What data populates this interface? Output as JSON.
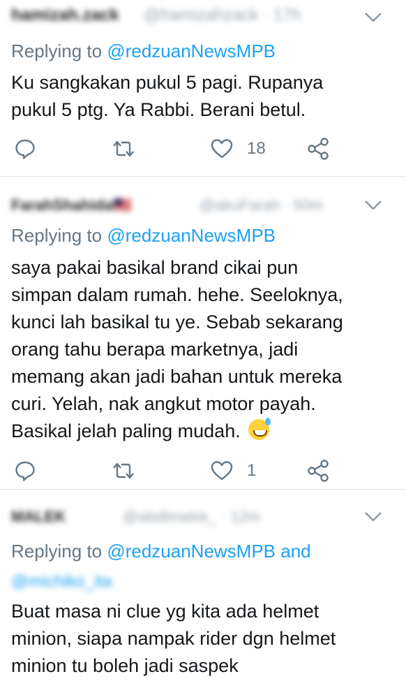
{
  "tweets": [
    {
      "author": "hamizah.zack",
      "handle": "@hamizahzack · 17h",
      "replying_prefix": "Replying to ",
      "replying_mention": "@redzuanNewsMPB",
      "text_lines": [
        "Ku sangkakan pukul 5 pagi. Rupanya",
        "pukul 5 ptg. Ya Rabbi. Berani betul."
      ],
      "likes": "18"
    },
    {
      "author": "FarahShahida🇲🇾",
      "handle": "@akuFarah · 50m",
      "replying_prefix": "Replying to ",
      "replying_mention": "@redzuanNewsMPB",
      "text_lines": [
        "saya pakai basikal brand cikai pun",
        "simpan dalam rumah. hehe. Seeloknya,",
        "kunci lah basikal tu ye. Sebab sekarang",
        "orang tahu berapa marketnya, jadi",
        "memang akan jadi bahan untuk mereka",
        "curi. Yelah, nak angkut motor payah.",
        "Basikal jelah paling mudah."
      ],
      "likes": "1"
    },
    {
      "author": "MALEK",
      "handle": "@abdlmalek_ · 12m",
      "replying_prefix": "Replying to ",
      "replying_mention": "@redzuanNewsMPB and",
      "extra_mention": "@michiko_ita",
      "text_lines": [
        "Buat masa ni clue yg kita ada helmet",
        "minion, siapa nampak rider dgn helmet",
        "minion tu boleh jadi saspek"
      ]
    }
  ],
  "icons": {
    "reply": "reply-icon",
    "retweet": "retweet-icon",
    "like": "heart-icon",
    "share": "share-icon",
    "menu": "chevron-down-icon"
  },
  "colors": {
    "link": "#1da1f2",
    "secondary_text": "#657786",
    "icon": "#657786",
    "divider": "#dfe3e6"
  }
}
